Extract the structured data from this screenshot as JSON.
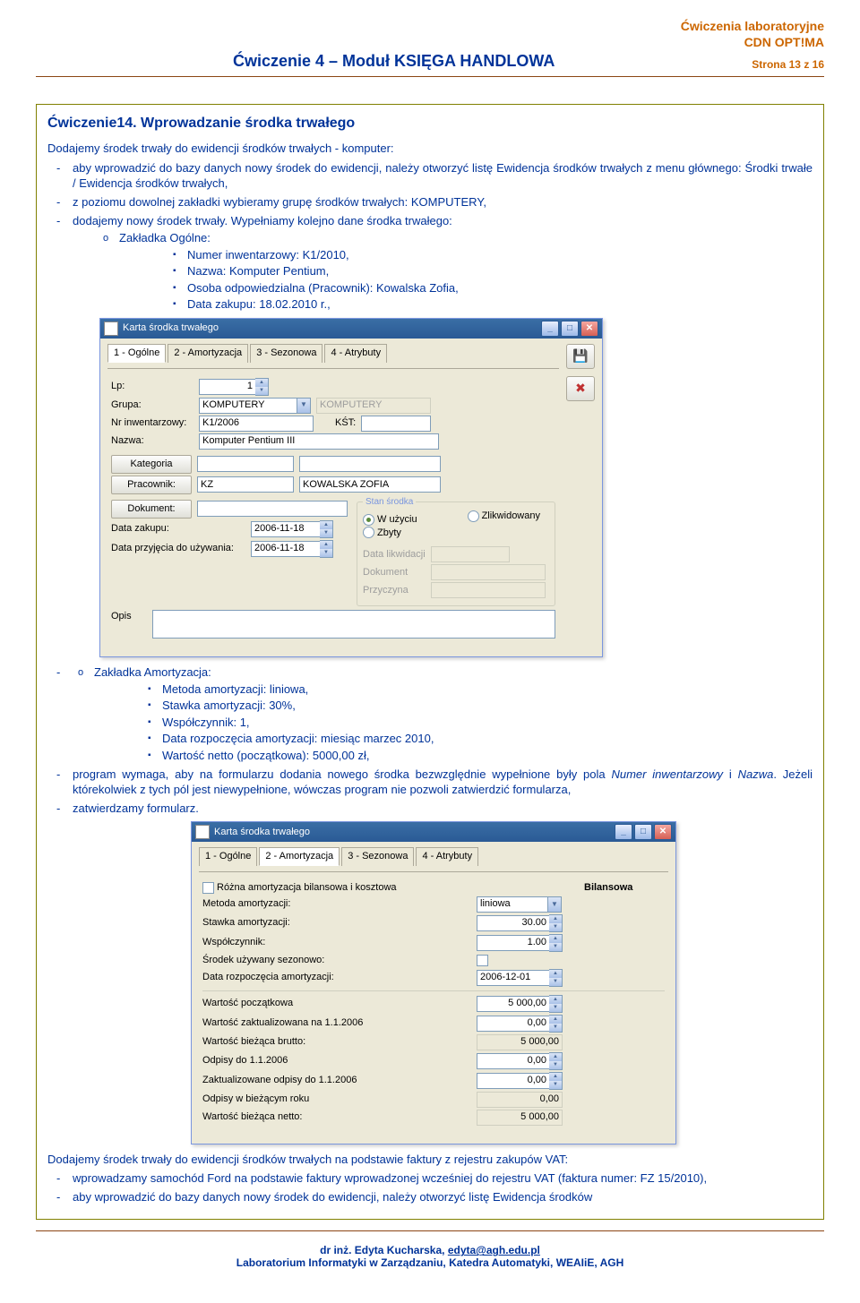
{
  "header": {
    "lab": "Ćwiczenia laboratoryjne",
    "app": "CDN OPT!MA",
    "title": "Ćwiczenie 4 – Moduł KSIĘGA HANDLOWA",
    "page": "Strona 13 z 16"
  },
  "exercise": {
    "title": "Ćwiczenie14. Wprowadzanie środka trwałego",
    "intro": "Dodajemy środek trwały do ewidencji środków trwałych - komputer:",
    "b1": "aby wprowadzić do bazy danych nowy środek do ewidencji, należy otworzyć listę Ewidencja środków trwałych z menu głównego: Środki trwałe / Ewidencja środków trwałych,",
    "b2": "z poziomu dowolnej zakładki wybieramy grupę środków trwałych: KOMPUTERY,",
    "b3": "dodajemy nowy środek trwały. Wypełniamy kolejno dane środka trwałego:",
    "zo": "Zakładka Ogólne:",
    "zo1": "Numer inwentarzowy: K1/2010,",
    "zo2": "Nazwa: Komputer Pentium,",
    "zo3": "Osoba odpowiedzialna (Pracownik): Kowalska Zofia,",
    "zo4": "Data zakupu: 18.02.2010 r.,",
    "za": "Zakładka Amortyzacja:",
    "za1": "Metoda amortyzacji: liniowa,",
    "za2": "Stawka amortyzacji: 30%,",
    "za3": "Współczynnik: 1,",
    "za4": "Data rozpoczęcia amortyzacji: miesiąc marzec 2010,",
    "za5": "Wartość netto (początkowa): 5000,00 zł,",
    "b4a": "program wymaga, aby na formularzu dodania nowego środka bezwzględnie wypełnione były pola ",
    "b4b": "Numer inwentarzowy",
    "b4c": " i ",
    "b4d": "Nazwa",
    "b4e": ". Jeżeli którekolwiek z tych pól jest niewypełnione, wówczas program nie pozwoli zatwierdzić formularza,",
    "b5": "zatwierdzamy formularz.",
    "p2": "Dodajemy środek trwały do ewidencji środków trwałych na podstawie faktury z rejestru zakupów VAT:",
    "p2a": "wprowadzamy samochód Ford na podstawie faktury wprowadzonej wcześniej do rejestru VAT (faktura numer: FZ 15/2010),",
    "p2b": "aby wprowadzić do bazy danych nowy środek do ewidencji, należy otworzyć listę Ewidencja środków"
  },
  "win1": {
    "title": "Karta środka trwałego",
    "tabs": [
      "1 - Ogólne",
      "2 - Amortyzacja",
      "3 - Sezonowa",
      "4 - Atrybuty"
    ],
    "lp_lbl": "Lp:",
    "lp": "1",
    "grupa_lbl": "Grupa:",
    "grupa": "KOMPUTERY",
    "grupa2": "KOMPUTERY",
    "nr_lbl": "Nr inwentarzowy:",
    "nr": "K1/2006",
    "kst_lbl": "KŚT:",
    "nazwa_lbl": "Nazwa:",
    "nazwa": "Komputer Pentium III",
    "kategoria_btn": "Kategoria",
    "pracownik_btn": "Pracownik:",
    "prac_code": "KZ",
    "prac_name": "KOWALSKA ZOFIA",
    "dokument_btn": "Dokument:",
    "dz_lbl": "Data zakupu:",
    "dz": "2006-11-18",
    "du_lbl": "Data przyjęcia do używania:",
    "du": "2006-11-18",
    "opis_lbl": "Opis",
    "gb": "Stan środka",
    "r1": "W użyciu",
    "r2": "Zlikwidowany",
    "r3": "Zbyty",
    "dl": "Data likwidacji",
    "dk": "Dokument",
    "pr": "Przyczyna"
  },
  "win2": {
    "title": "Karta środka trwałego",
    "tabs": [
      "1 - Ogólne",
      "2 - Amortyzacja",
      "3 - Sezonowa",
      "4 - Atrybuty"
    ],
    "chk_lbl": "Różna amortyzacja bilansowa i kosztowa",
    "col": "Bilansowa",
    "l_met": "Metoda amortyzacji:",
    "v_met": "liniowa",
    "l_st": "Stawka amortyzacji:",
    "v_st": "30.00",
    "l_ws": "Współczynnik:",
    "v_ws": "1.00",
    "l_sez": "Środek używany sezonowo:",
    "l_dra": "Data rozpoczęcia amortyzacji:",
    "v_dra": "2006-12-01",
    "l_wp": "Wartość początkowa",
    "v_wp": "5 000,00",
    "l_wa": "Wartość zaktualizowana na 1.1.2006",
    "v_wa": "0,00",
    "l_wbb": "Wartość bieżąca brutto:",
    "v_wbb": "5 000,00",
    "l_od": "Odpisy do 1.1.2006",
    "v_od": "0,00",
    "l_zod": "Zaktualizowane odpisy do 1.1.2006",
    "v_zod": "0,00",
    "l_obr": "Odpisy w bieżącym roku",
    "v_obr": "0,00",
    "l_wbn": "Wartość bieżąca netto:",
    "v_wbn": "5 000,00"
  },
  "footer": {
    "l1a": "dr inż. Edyta Kucharska, ",
    "l1b": "edyta@agh.edu.pl",
    "l2": "Laboratorium Informatyki w Zarządzaniu, Katedra Automatyki, WEAIiE, AGH"
  }
}
